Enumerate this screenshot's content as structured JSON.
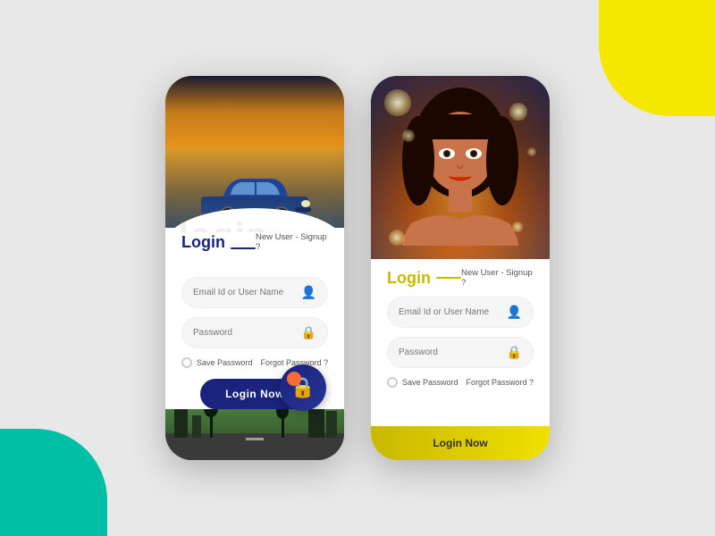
{
  "background": {
    "teal_color": "#00bfa5",
    "yellow_color": "#f5e800",
    "gray_color": "#e8e8e8"
  },
  "phone1": {
    "watermark_text": "login",
    "form": {
      "title": "Login",
      "line": "—",
      "signup_link": "New User - Signup ?",
      "email_placeholder": "Email Id or User Name",
      "password_placeholder": "Password",
      "save_password_label": "Save Password",
      "forgot_password_label": "Forgot Password ?",
      "login_button_label": "Login Now"
    }
  },
  "phone2": {
    "form": {
      "title": "Login",
      "signup_link": "New User - Signup ?",
      "email_placeholder": "Email Id or User Name",
      "password_placeholder": "Password",
      "save_password_label": "Save Password",
      "forgot_password_label": "Forgot Password ?",
      "login_button_label": "Login Now"
    }
  }
}
